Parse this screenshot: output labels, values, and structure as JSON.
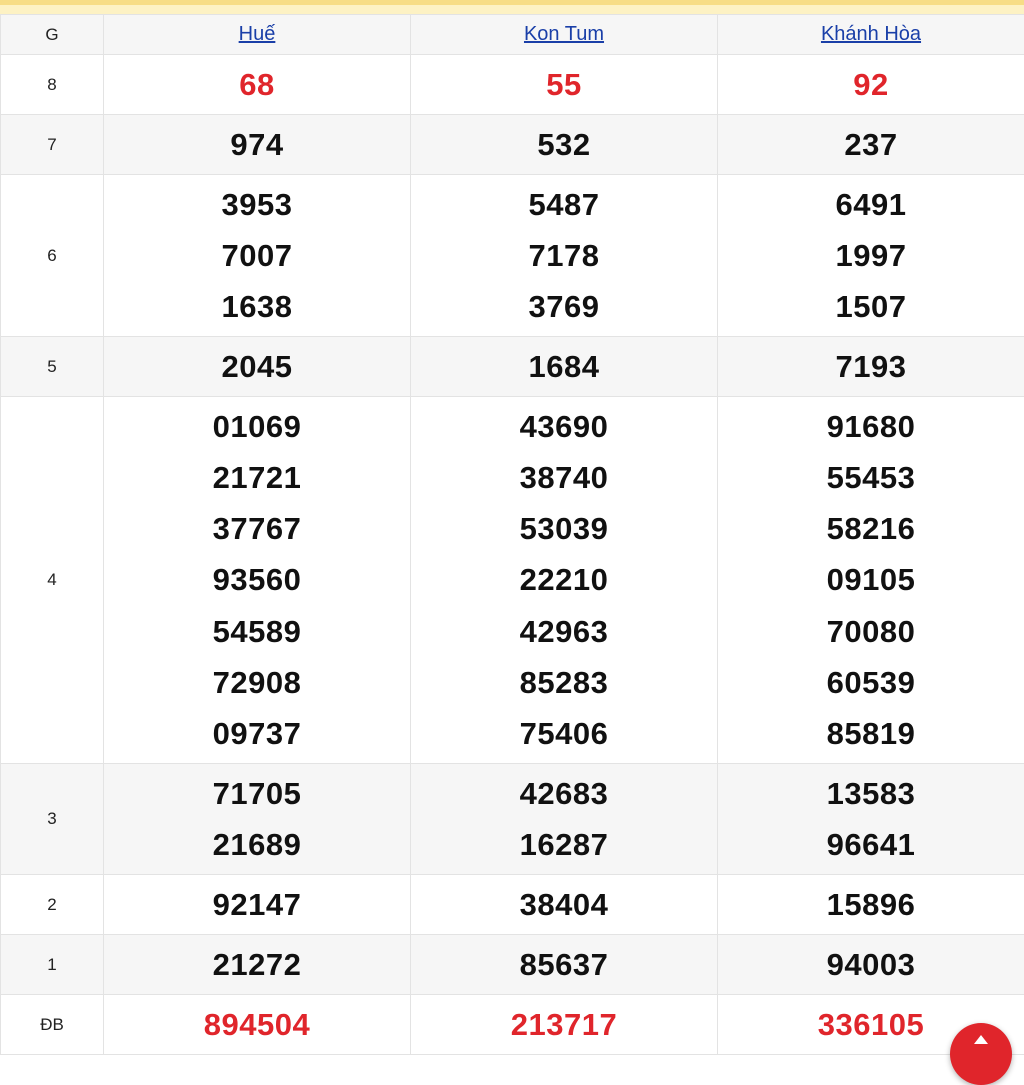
{
  "header": {
    "g_label": "G",
    "provinces": [
      "Huế",
      "Kon Tum",
      "Khánh Hòa"
    ]
  },
  "prizes": [
    {
      "label": "8",
      "values": [
        [
          "68"
        ],
        [
          "55"
        ],
        [
          "92"
        ]
      ],
      "highlight": true
    },
    {
      "label": "7",
      "values": [
        [
          "974"
        ],
        [
          "532"
        ],
        [
          "237"
        ]
      ]
    },
    {
      "label": "6",
      "values": [
        [
          "3953",
          "7007",
          "1638"
        ],
        [
          "5487",
          "7178",
          "3769"
        ],
        [
          "6491",
          "1997",
          "1507"
        ]
      ]
    },
    {
      "label": "5",
      "values": [
        [
          "2045"
        ],
        [
          "1684"
        ],
        [
          "7193"
        ]
      ]
    },
    {
      "label": "4",
      "values": [
        [
          "01069",
          "21721",
          "37767",
          "93560",
          "54589",
          "72908",
          "09737"
        ],
        [
          "43690",
          "38740",
          "53039",
          "22210",
          "42963",
          "85283",
          "75406"
        ],
        [
          "91680",
          "55453",
          "58216",
          "09105",
          "70080",
          "60539",
          "85819"
        ]
      ]
    },
    {
      "label": "3",
      "values": [
        [
          "71705",
          "21689"
        ],
        [
          "42683",
          "16287"
        ],
        [
          "13583",
          "96641"
        ]
      ]
    },
    {
      "label": "2",
      "values": [
        [
          "92147"
        ],
        [
          "38404"
        ],
        [
          "15896"
        ]
      ]
    },
    {
      "label": "1",
      "values": [
        [
          "21272"
        ],
        [
          "85637"
        ],
        [
          "94003"
        ]
      ]
    },
    {
      "label": "ĐB",
      "values": [
        [
          "894504"
        ],
        [
          "213717"
        ],
        [
          "336105"
        ]
      ],
      "highlight": true
    }
  ],
  "colors": {
    "accent_red": "#e0252b",
    "link_blue": "#1a3fa8",
    "top_bar": "#fdf2c4"
  },
  "icons": {
    "fab": "arrow-up-icon"
  }
}
